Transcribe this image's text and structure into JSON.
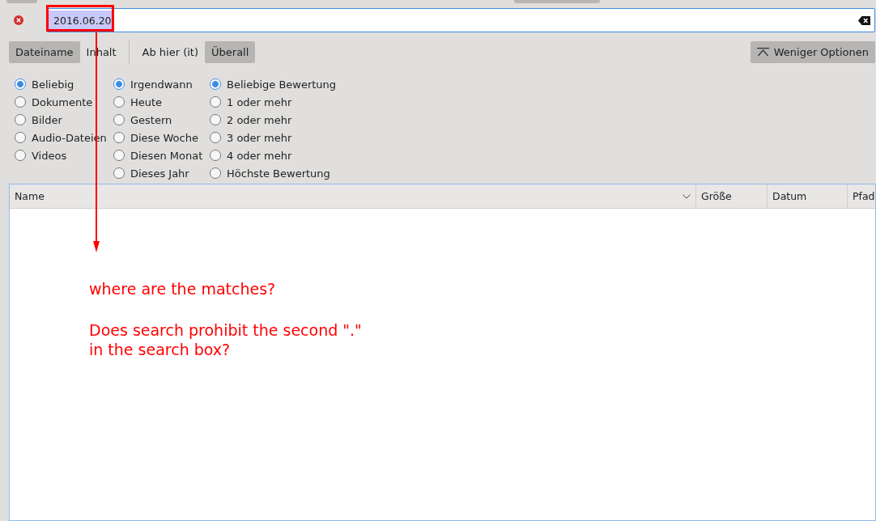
{
  "search": {
    "value": "2016.06.20",
    "text_selected": true
  },
  "scope_groups": [
    [
      {
        "label": "Dateiname",
        "selected": true
      },
      {
        "label": "Inhalt",
        "selected": false
      }
    ],
    [
      {
        "label": "Ab hier (it)",
        "selected": false
      },
      {
        "label": "Überall",
        "selected": true
      }
    ]
  ],
  "options_button": {
    "label": "Weniger Optionen"
  },
  "filter_groups": [
    {
      "options": [
        {
          "label": "Beliebig",
          "selected": true
        },
        {
          "label": "Dokumente",
          "selected": false
        },
        {
          "label": "Bilder",
          "selected": false
        },
        {
          "label": "Audio-Dateien",
          "selected": false
        },
        {
          "label": "Videos",
          "selected": false
        }
      ]
    },
    {
      "options": [
        {
          "label": "Irgendwann",
          "selected": true
        },
        {
          "label": "Heute",
          "selected": false
        },
        {
          "label": "Gestern",
          "selected": false
        },
        {
          "label": "Diese Woche",
          "selected": false
        },
        {
          "label": "Diesen Monat",
          "selected": false
        },
        {
          "label": "Dieses Jahr",
          "selected": false
        }
      ]
    },
    {
      "options": [
        {
          "label": "Beliebige Bewertung",
          "selected": true
        },
        {
          "label": "1 oder mehr",
          "selected": false
        },
        {
          "label": "2 oder mehr",
          "selected": false
        },
        {
          "label": "3 oder mehr",
          "selected": false
        },
        {
          "label": "4 oder mehr",
          "selected": false
        },
        {
          "label": "Höchste Bewertung",
          "selected": false
        }
      ]
    }
  ],
  "table": {
    "columns": [
      "Name",
      "Größe",
      "Datum",
      "Pfad"
    ]
  },
  "annotation": {
    "lines": [
      "where are the matches?",
      "Does search prohibit the second \".\"",
      "in the search box?"
    ]
  }
}
